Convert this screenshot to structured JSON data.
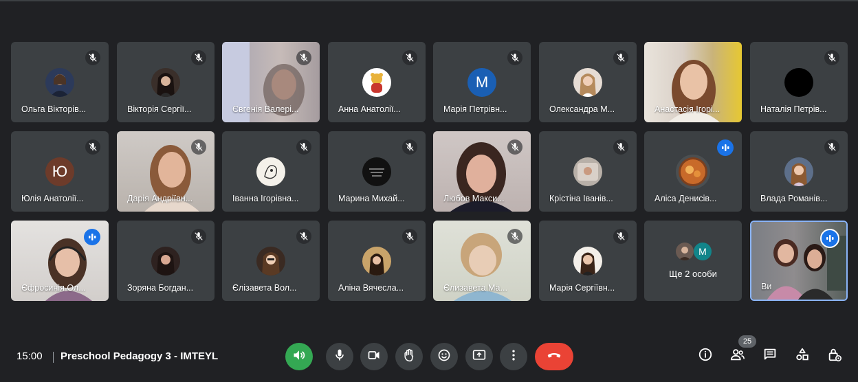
{
  "participants": [
    {
      "name": "Ольга Вікторів...",
      "muted": true
    },
    {
      "name": "Вікторія Сергії...",
      "muted": true
    },
    {
      "name": "Євгенія Валері...",
      "muted": true
    },
    {
      "name": "Анна Анатолії...",
      "muted": true
    },
    {
      "name": "Марія Петрівн...",
      "muted": true,
      "initial": "M"
    },
    {
      "name": "Олександра М...",
      "muted": true
    },
    {
      "name": "Анастасія Ігорі...",
      "muted": false
    },
    {
      "name": "Наталія Петрів...",
      "muted": true
    },
    {
      "name": "Юлія Анатолії...",
      "muted": true,
      "initial": "Ю"
    },
    {
      "name": "Дарія Андріївн...",
      "muted": true
    },
    {
      "name": "Іванна Ігорівна...",
      "muted": true
    },
    {
      "name": "Марина Михай...",
      "muted": true
    },
    {
      "name": "Любов Макси...",
      "muted": true
    },
    {
      "name": "Крістіна Іванів...",
      "muted": true
    },
    {
      "name": "Аліса Денисів...",
      "muted": false,
      "speaking": true
    },
    {
      "name": "Влада Романів...",
      "muted": true
    },
    {
      "name": "Єфросинія Ол...",
      "muted": false,
      "speaking": true
    },
    {
      "name": "Зоряна Богдан...",
      "muted": true
    },
    {
      "name": "Єлізавета Вол...",
      "muted": true
    },
    {
      "name": "Аліна Вячесла...",
      "muted": true
    },
    {
      "name": "Єлизавета Ма...",
      "muted": true
    },
    {
      "name": "Марія Сергіївн...",
      "muted": true
    }
  ],
  "more_tile": {
    "label": "Ще 2 особи",
    "initial": "M"
  },
  "self_tile": {
    "name": "Ви",
    "speaking": true
  },
  "bottom_bar": {
    "time": "15:00",
    "meeting_title": "Preschool Pedagogy 3 - IMTEYL",
    "participant_count": "25"
  },
  "controls": [
    "volume-icon",
    "mic-icon",
    "camera-icon",
    "raise-hand-icon",
    "emoji-icon",
    "present-icon",
    "more-options-icon",
    "end-call-icon"
  ],
  "right_icons": [
    "info-icon",
    "people-icon",
    "chat-icon",
    "activities-icon",
    "host-controls-icon"
  ],
  "colors": {
    "background": "#202124",
    "tile": "#3c4043",
    "speaking": "#1a73e8",
    "end_call": "#ea4335",
    "audio_on": "#34a853"
  }
}
